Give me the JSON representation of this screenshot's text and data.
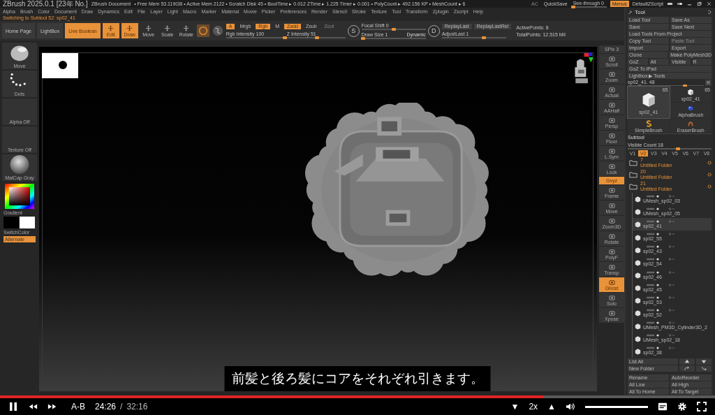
{
  "title_bar": {
    "app": "ZBrush 2025.0.1 [23年 No.]",
    "document": "ZBrush Document",
    "stats": "• Free Mem 53.119GB • Active Mem 2122 • Scratch Disk 45 • BoolTime ▸ 0.012 ZTime ▸ 1.225 Timer ▸ 0.001 • PolyCount ▸ 492.156 KP • MeshCount ▸ 6",
    "ac": "AC",
    "quicksave": "QuickSave",
    "see_through": {
      "label": "See-through 0",
      "level": 0
    },
    "menus": {
      "label": "Menus",
      "on": true
    },
    "script": "DefaultZScript"
  },
  "menu_bar": [
    "Alpha",
    "Brush",
    "Color",
    "Document",
    "Draw",
    "Dynamics",
    "Edit",
    "File",
    "Layer",
    "Light",
    "Macro",
    "Marker",
    "Material",
    "Movie",
    "Picker",
    "Preferences",
    "Render",
    "Stencil",
    "Stroke",
    "Texture",
    "Tool",
    "Transform",
    "Zplugin",
    "Zscript",
    "Help"
  ],
  "notice": "Switching to Subtool 52: sp02_41",
  "shelf": {
    "nav": [
      {
        "kind": "text",
        "label": "Home Page",
        "on": false
      },
      {
        "kind": "text",
        "label": "LightBox",
        "on": false
      },
      {
        "kind": "text",
        "label": "Live Boolean",
        "on": true
      },
      {
        "kind": "icon",
        "label": "Edit",
        "on": true
      },
      {
        "kind": "icon",
        "label": "Draw",
        "on": true
      },
      {
        "kind": "icon",
        "label": "Move",
        "on": false
      },
      {
        "kind": "icon",
        "label": "Scale",
        "on": false
      },
      {
        "kind": "icon",
        "label": "Rotate",
        "on": false
      }
    ],
    "toggles": [
      {
        "label": "A",
        "on": true,
        "disabled": false
      },
      {
        "label": "Mrgb",
        "on": false,
        "disabled": false
      },
      {
        "label": "Rgb",
        "on": true,
        "disabled": false
      },
      {
        "label": "M",
        "on": false,
        "disabled": false
      },
      {
        "label": "Zadd",
        "on": true,
        "disabled": false
      },
      {
        "label": "Zsub",
        "on": false,
        "disabled": false
      },
      {
        "label": "Zcut",
        "on": false,
        "disabled": true
      }
    ],
    "intensity": [
      {
        "label": "Rgb Intensity 100",
        "level": 1
      },
      {
        "label": "Z Intensity 51",
        "level": 0.51
      }
    ],
    "focal_letter": "S",
    "focal": [
      {
        "label": "Focal Shift 0",
        "level": 0.5
      },
      {
        "label": "Draw Size 1",
        "level": 0.02
      }
    ],
    "dynamic": "Dynamic",
    "replay_letter": "D",
    "replay": [
      "ReplayLast",
      "ReplayLastRel"
    ],
    "adjust_last": {
      "label": "AdjustLast 1",
      "level": 0.65
    },
    "active_points": "ActivePoints: 8",
    "total_points": "TotalPoints: 12.515 Mil"
  },
  "left_shelf": {
    "slots": [
      {
        "kind": "brush",
        "label": "Move"
      },
      {
        "kind": "stroke",
        "label": "Dots"
      },
      {
        "kind": "empty",
        "label": "Alpha Off"
      },
      {
        "kind": "empty",
        "label": "Texture Off"
      },
      {
        "kind": "material",
        "label": "MatCap Gray"
      }
    ],
    "gradient": "Gradient",
    "switch_color": "SwitchColor",
    "alternate": {
      "label": "Alternate",
      "on": true
    }
  },
  "right_shelf": [
    {
      "kind": "text",
      "label": "SPix 3",
      "on": false
    },
    {
      "kind": "icon",
      "label": "Scroll",
      "on": false
    },
    {
      "kind": "icon",
      "label": "Zoom",
      "on": false
    },
    {
      "kind": "icon",
      "label": "Actual",
      "on": false
    },
    {
      "kind": "icon",
      "label": "AAHalf",
      "on": false
    },
    {
      "kind": "icon",
      "label": "Persp",
      "on": false
    },
    {
      "kind": "icon",
      "label": "Floor",
      "on": false
    },
    {
      "kind": "icon",
      "label": "L.Sym",
      "on": false
    },
    {
      "kind": "icon",
      "label": "Lock",
      "on": false
    },
    {
      "kind": "text",
      "label": "Gxyz",
      "on": true
    },
    {
      "kind": "icon",
      "label": "Frame",
      "on": false
    },
    {
      "kind": "icon",
      "label": "Move",
      "on": false
    },
    {
      "kind": "icon",
      "label": "Zoom3D",
      "on": false
    },
    {
      "kind": "icon",
      "label": "Rotate",
      "on": false
    },
    {
      "kind": "icon",
      "label": "PolyF",
      "on": false
    },
    {
      "kind": "icon",
      "label": "Transp",
      "on": false
    },
    {
      "kind": "icon",
      "label": "Ghost",
      "on": true
    },
    {
      "kind": "icon",
      "label": "Solo",
      "on": false
    },
    {
      "kind": "icon",
      "label": "Xpose",
      "on": false
    }
  ],
  "tool_panel": {
    "title": "Tool",
    "buttons": [
      [
        {
          "label": "Load Tool",
          "disabled": false
        },
        {
          "label": "Save As",
          "disabled": false
        }
      ],
      [
        {
          "label": "Save",
          "disabled": false
        },
        {
          "label": "Save Next",
          "disabled": false
        }
      ],
      [
        {
          "label": "Load Tools From Project",
          "disabled": false
        }
      ],
      [
        {
          "label": "Copy Tool",
          "disabled": false
        },
        {
          "label": "Paste Tool",
          "disabled": true
        }
      ],
      [
        {
          "label": "Import",
          "disabled": false
        },
        {
          "label": "Export",
          "disabled": false
        }
      ],
      [
        {
          "label": "Clone",
          "disabled": false
        },
        {
          "label": "Make PolyMesh3D",
          "disabled": false
        }
      ],
      [
        {
          "label": "GoZ",
          "disabled": false
        },
        {
          "label": "All",
          "disabled": false
        },
        {
          "label": "Visible",
          "disabled": false
        },
        {
          "label": "R",
          "disabled": false
        }
      ],
      [
        {
          "label": "GoZ To iPad",
          "disabled": false
        }
      ],
      [
        {
          "label": "Lightbox ▶ Tools",
          "disabled": false
        }
      ]
    ],
    "tool_slider": {
      "label": "sp02_41. 48",
      "level": 0.75
    },
    "tool_slider_r": "R",
    "thumbs": [
      {
        "kind": "cube",
        "label": "sp02_41",
        "count": "65",
        "selected": true
      },
      {
        "kind": "cube",
        "label": "sp02_41",
        "count": "65",
        "selected": false
      },
      {
        "kind": "alpha",
        "label": "AlphaBrush",
        "selected": false
      },
      {
        "kind": "simple",
        "label": "SimpleBrush",
        "selected": false
      },
      {
        "kind": "eraser",
        "label": "EraserBrush",
        "selected": false
      }
    ],
    "subtool": {
      "title": "Subtool",
      "visible_count": {
        "label": "Visible Count 18",
        "level": 0.6
      },
      "versions": [
        {
          "label": "V1",
          "selected": false
        },
        {
          "label": "V2",
          "selected": true
        },
        {
          "label": "V3",
          "selected": false
        },
        {
          "label": "V4",
          "selected": false
        },
        {
          "label": "V5",
          "selected": false
        },
        {
          "label": "V6",
          "selected": false
        },
        {
          "label": "V7",
          "selected": false
        },
        {
          "label": "V8",
          "selected": false
        }
      ],
      "folders": [
        {
          "count": "7",
          "name": "Untitled Folder"
        },
        {
          "count": "20",
          "name": "Untitled Folder"
        },
        {
          "count": "21",
          "name": "Untitled Folder"
        }
      ],
      "items": [
        {
          "name": "UMesh_sp02_03",
          "selected": false
        },
        {
          "name": "UMesh_sp02_05",
          "selected": false
        },
        {
          "name": "sp02_41",
          "selected": true
        },
        {
          "name": "sp02_55",
          "selected": false
        },
        {
          "name": "sp02_43",
          "selected": false
        },
        {
          "name": "sp02_54",
          "selected": false
        },
        {
          "name": "sp02_46",
          "selected": false
        },
        {
          "name": "sp02_45",
          "selected": false
        },
        {
          "name": "sp02_53",
          "selected": false
        },
        {
          "name": "sp02_52",
          "selected": false
        },
        {
          "name": "UMesh_PM3D_Cylinder3D_2",
          "selected": false
        },
        {
          "name": "UMesh_sp02_18",
          "selected": false
        },
        {
          "name": "sp02_38",
          "selected": false
        }
      ],
      "list_all": "List All",
      "new_folder": "New Folder",
      "bottom": [
        "Rename",
        "AutoReorder",
        "All Low",
        "All High",
        "All To Home",
        "All To Target"
      ]
    }
  },
  "subtitle": "前髪と後ろ髪にコアをそれぞれ引きます。",
  "player": {
    "progress": {
      "level": 0.76
    },
    "ab": "A-B",
    "time": "24:26",
    "separator": "/",
    "duration": "32:16",
    "speed_down": "▼",
    "speed": "2x",
    "speed_up": "▲",
    "volume": {
      "level": 1
    }
  }
}
